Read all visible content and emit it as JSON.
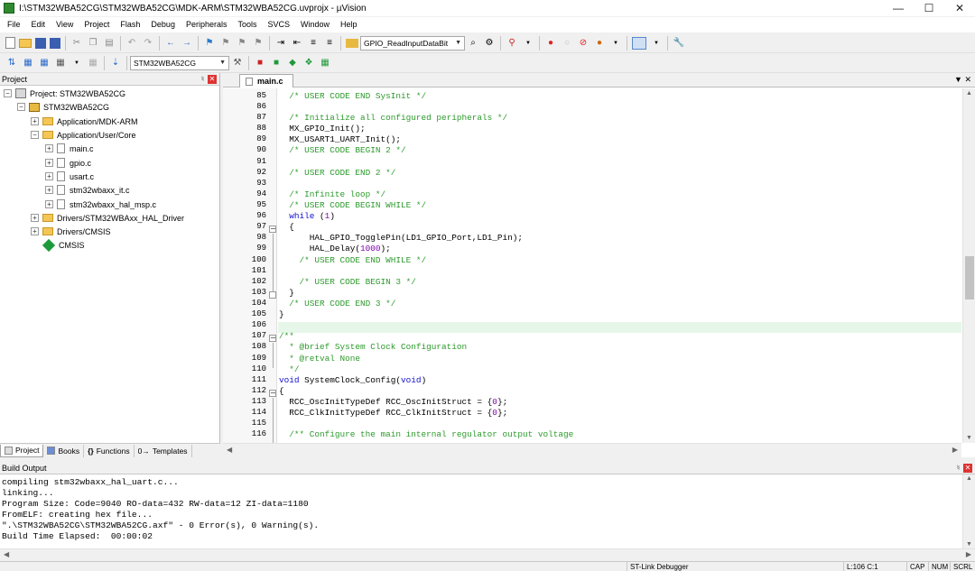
{
  "window": {
    "title": "I:\\STM32WBA52CG\\STM32WBA52CG\\MDK-ARM\\STM32WBA52CG.uvprojx - µVision"
  },
  "menu": [
    "File",
    "Edit",
    "View",
    "Project",
    "Flash",
    "Debug",
    "Peripherals",
    "Tools",
    "SVCS",
    "Window",
    "Help"
  ],
  "toolbar": {
    "function_combo": "GPIO_ReadInputDataBit",
    "target_combo": "STM32WBA52CG"
  },
  "project_panel": {
    "title": "Project",
    "root": "Project: STM32WBA52CG",
    "target": "STM32WBA52CG",
    "groups": {
      "mdk_arm": "Application/MDK-ARM",
      "user_core": "Application/User/Core",
      "files": [
        "main.c",
        "gpio.c",
        "usart.c",
        "stm32wbaxx_it.c",
        "stm32wbaxx_hal_msp.c"
      ],
      "hal_driver": "Drivers/STM32WBAxx_HAL_Driver",
      "drivers_cmsis": "Drivers/CMSIS",
      "cmsis": "CMSIS"
    },
    "tabs": [
      "Project",
      "Books",
      "Functions",
      "Templates"
    ]
  },
  "editor": {
    "tab": "main.c",
    "line_numbers": [
      "85",
      "86",
      "87",
      "88",
      "89",
      "90",
      "91",
      "92",
      "93",
      "94",
      "95",
      "96",
      "97",
      "98",
      "99",
      "100",
      "101",
      "102",
      "103",
      "104",
      "105",
      "106",
      "107",
      "108",
      "109",
      "110",
      "111",
      "112",
      "113",
      "114",
      "115",
      "116"
    ]
  },
  "build_output": {
    "title": "Build Output",
    "lines": [
      "compiling stm32wbaxx_hal_uart.c...",
      "linking...",
      "Program Size: Code=9040 RO-data=432 RW-data=12 ZI-data=1180",
      "FromELF: creating hex file...",
      "\".\\STM32WBA52CG\\STM32WBA52CG.axf\" - 0 Error(s), 0 Warning(s).",
      "Build Time Elapsed:  00:00:02"
    ]
  },
  "status": {
    "debugger": "ST-Link Debugger",
    "position": "L:106 C:1",
    "cap": "CAP",
    "num": "NUM",
    "scrl": "SCRL"
  },
  "colors": {
    "comment": "#2d9a2d",
    "keyword": "#1010d0",
    "number": "#8000b0",
    "current_line": "#e6f7e9"
  }
}
